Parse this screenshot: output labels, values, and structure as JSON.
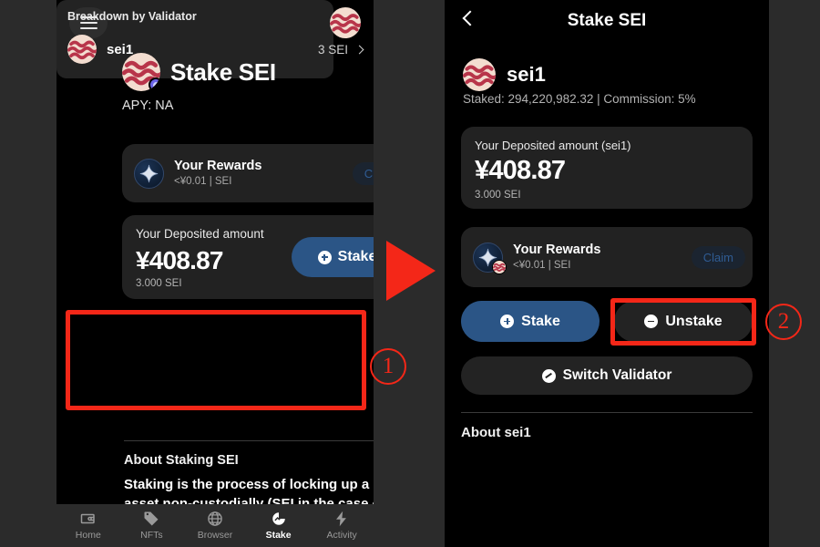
{
  "colors": {
    "accent_red": "#f42718",
    "blue_button": "#2b5586",
    "card_bg": "#222222",
    "screen_bg": "#000000",
    "outer_bg": "#2b2b2b",
    "claim_text": "#2f5c93"
  },
  "left_screen": {
    "menu_icon": "hamburger-icon",
    "brand_icon": "sei-logo-icon",
    "title": "Stake SEI",
    "apy": "APY: NA",
    "rewards_card": {
      "icon": "rewards-diamond-icon",
      "title": "Your Rewards",
      "subtitle": "<¥0.01 | SEI",
      "claim_label": "Claim"
    },
    "deposit_card": {
      "label": "Your Deposited amount",
      "amount": "¥408.87",
      "sei_amount": "3.000 SEI",
      "stake_label": "Stake"
    },
    "validator_card": {
      "title": "Breakdown by Validator",
      "rows": [
        {
          "name": "sei1",
          "amount": "3 SEI"
        }
      ]
    },
    "about": {
      "heading": "About Staking SEI",
      "body": "Staking is the process of locking up a digital asset non-custodially (SEI in the case of the"
    },
    "nav": [
      {
        "label": "Home",
        "icon": "wallet-icon",
        "active": false
      },
      {
        "label": "NFTs",
        "icon": "tag-icon",
        "active": false
      },
      {
        "label": "Browser",
        "icon": "globe-icon",
        "active": false
      },
      {
        "label": "Stake",
        "icon": "chart-icon",
        "active": true
      },
      {
        "label": "Activity",
        "icon": "bolt-icon",
        "active": false
      }
    ]
  },
  "right_screen": {
    "back_icon": "chevron-left-icon",
    "title": "Stake SEI",
    "validator": {
      "name": "sei1",
      "stats": "Staked: 294,220,982.32 | Commission: 5%"
    },
    "deposit_card": {
      "label": "Your Deposited amount (sei1)",
      "amount": "¥408.87",
      "sei_amount": "3.000 SEI"
    },
    "rewards_card": {
      "icon": "rewards-diamond-icon",
      "title": "Your Rewards",
      "subtitle": "<¥0.01 | SEI",
      "claim_label": "Claim"
    },
    "actions": {
      "stake_label": "Stake",
      "unstake_label": "Unstake",
      "switch_label": "Switch Validator"
    },
    "about_heading": "About sei1"
  },
  "annotations": {
    "marker_1": "①",
    "marker_1_number": "1",
    "marker_2_number": "2",
    "arrow": "right-arrow-icon"
  }
}
